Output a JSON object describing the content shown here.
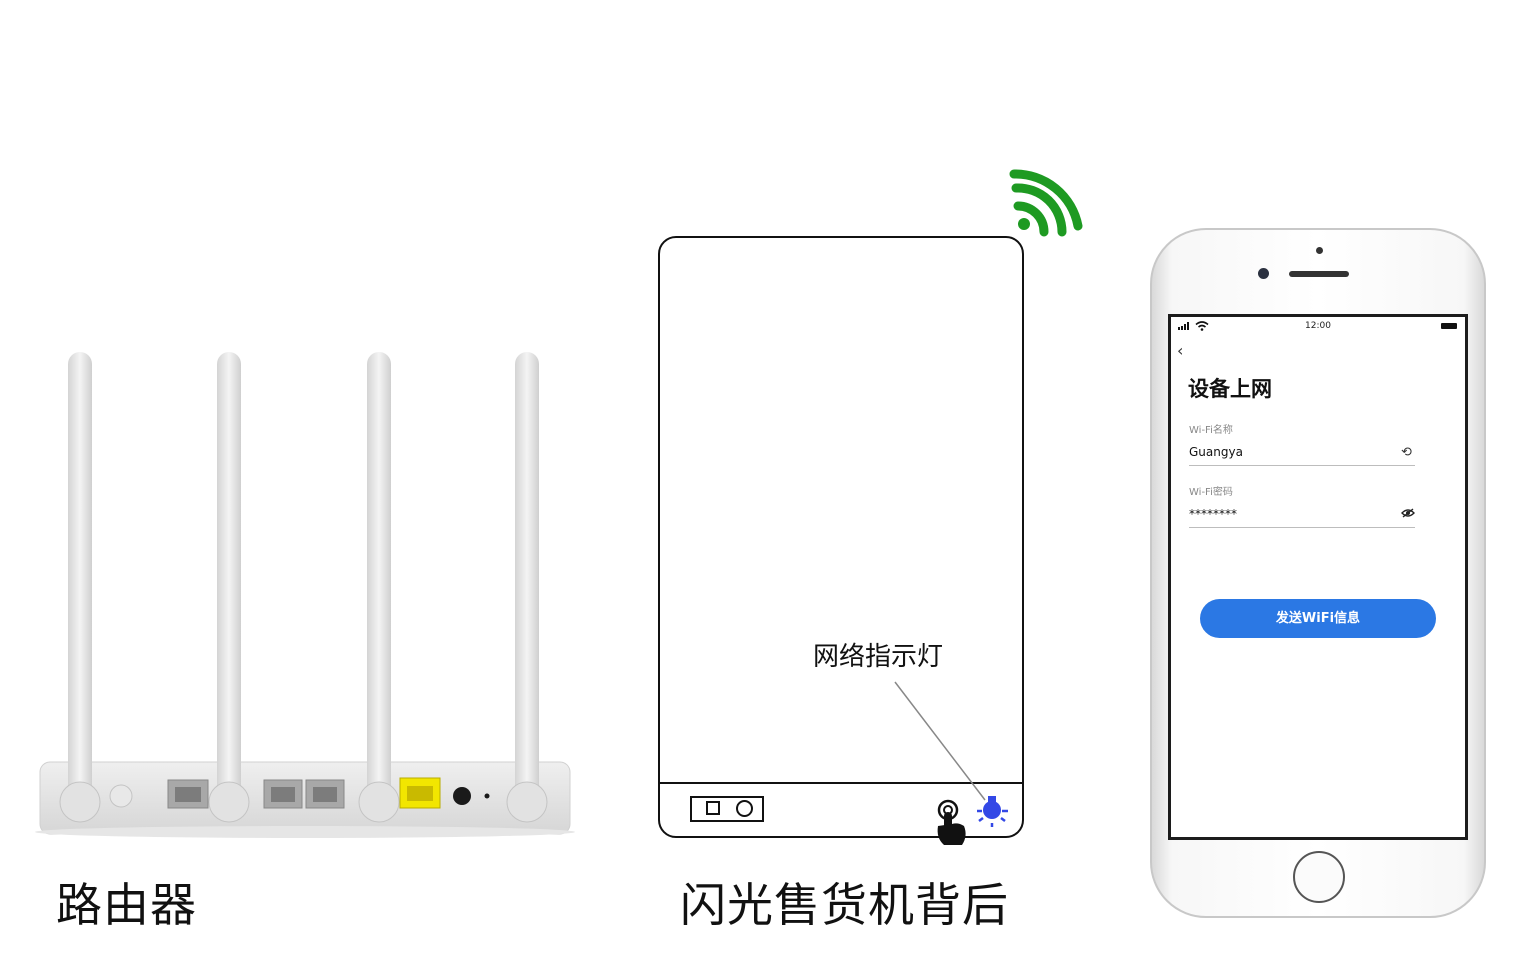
{
  "router": {
    "caption": "路由器"
  },
  "machine": {
    "caption": "闪光售货机背后",
    "indicator_label": "网络指示灯"
  },
  "phone": {
    "status_time": "12:00",
    "page_title": "设备上网",
    "ssid_label": "Wi-Fi名称",
    "ssid_value": "Guangya",
    "password_label": "Wi-Fi密码",
    "password_value": "********",
    "send_button_label": "发送WiFi信息"
  },
  "colors": {
    "wifi_signal": "#1e9a22",
    "indicator_light": "#3348e6",
    "router_port_yellow": "#f2e600",
    "send_button": "#2b78e4"
  },
  "icons": [
    "wifi-signal-icon",
    "light-bulb-icon",
    "tap-hand-icon",
    "back-chevron-icon",
    "refresh-icon",
    "eye-off-icon",
    "cellular-signal-icon",
    "wifi-icon",
    "battery-icon"
  ]
}
